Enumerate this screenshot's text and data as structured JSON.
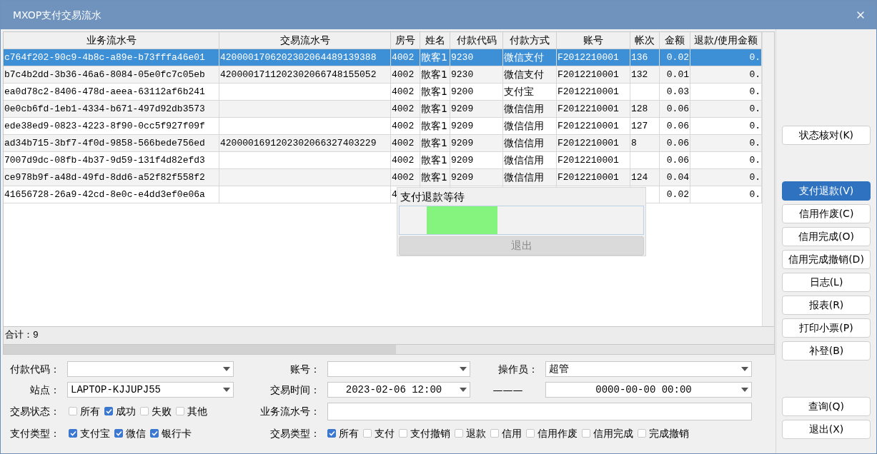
{
  "window": {
    "title": "MXOP支付交易流水"
  },
  "table": {
    "columns": [
      "业务流水号",
      "交易流水号",
      "房号",
      "姓名",
      "付款代码",
      "付款方式",
      "账号",
      "帐次",
      "金额",
      "退款/使用金额"
    ],
    "rows": [
      {
        "selected": true,
        "business_no": "c764f202-90c9-4b8c-a89e-b73fffa46e01",
        "trade_no": "4200001706202302064489139388",
        "room": "4002",
        "name": "散客1",
        "pay_code": "9230",
        "pay_method": "微信支付",
        "account": "F2012210001",
        "folio": "136",
        "amount": "0.02",
        "refund": "0."
      },
      {
        "selected": false,
        "business_no": "b7c4b2dd-3b36-46a6-8084-05e0fc7c05eb",
        "trade_no": "4200001711202302066748155052",
        "room": "4002",
        "name": "散客1",
        "pay_code": "9230",
        "pay_method": "微信支付",
        "account": "F2012210001",
        "folio": "132",
        "amount": "0.01",
        "refund": "0."
      },
      {
        "selected": false,
        "business_no": "ea0d78c2-8406-478d-aeea-63112af6b241",
        "room": "4002",
        "name": "散客1",
        "pay_code": "9200",
        "pay_method": "支付宝",
        "account": "F2012210001",
        "amount": "0.03",
        "refund": "0."
      },
      {
        "selected": false,
        "business_no": "0e0cb6fd-1eb1-4334-b671-497d92db3573",
        "room": "4002",
        "name": "散客1",
        "pay_code": "9209",
        "pay_method": "微信信用",
        "account": "F2012210001",
        "folio": "128",
        "amount": "0.06",
        "refund": "0."
      },
      {
        "selected": false,
        "business_no": "ede38ed9-0823-4223-8f90-0cc5f927f09f",
        "room": "4002",
        "name": "散客1",
        "pay_code": "9209",
        "pay_method": "微信信用",
        "account": "F2012210001",
        "folio": "127",
        "amount": "0.06",
        "refund": "0."
      },
      {
        "selected": false,
        "business_no": "ad34b715-3bf7-4f0d-9858-566bede756ed",
        "trade_no": "4200001691202302066327403229",
        "room": "4002",
        "name": "散客1",
        "pay_code": "9209",
        "pay_method": "微信信用",
        "account": "F2012210001",
        "folio": "8",
        "amount": "0.06",
        "refund": "0."
      },
      {
        "selected": false,
        "business_no": "7007d9dc-08fb-4b37-9d59-131f4d82efd3",
        "room": "4002",
        "name": "散客1",
        "pay_code": "9209",
        "pay_method": "微信信用",
        "account": "F2012210001",
        "amount": "0.06",
        "refund": "0."
      },
      {
        "selected": false,
        "business_no": "ce978b9f-a48d-49fd-8dd6-a52f82f558f2",
        "room": "4002",
        "name": "散客1",
        "pay_code": "9209",
        "pay_method": "微信信用",
        "account": "F2012210001",
        "folio": "124",
        "amount": "0.04",
        "refund": "0."
      },
      {
        "selected": false,
        "business_no": "41656728-26a9-42cd-8e0c-e4dd3ef0e06a",
        "room": "4",
        "amount": "0.02",
        "refund": "0."
      }
    ],
    "total": "合计：9"
  },
  "dialog": {
    "title": "支付退款等待",
    "progress": {
      "level": 0.29
    },
    "button": {
      "label": "退出",
      "disabled": true
    }
  },
  "filters": {
    "row1": [
      {
        "label": "付款代码：",
        "kind": "dropdown"
      },
      {
        "label": "账号：",
        "kind": "dropdown"
      },
      {
        "label": "操作员：",
        "kind": "dropdown",
        "value": "超管"
      }
    ],
    "row2": [
      {
        "label": "站点：",
        "kind": "dropdown",
        "value": "LAPTOP-KJJUPJ55"
      },
      {
        "label": "交易时间：",
        "kind": "dropdown",
        "value": "2023-02-06 12:00",
        "separator": "———",
        "to": {
          "kind": "dropdown",
          "value": "0000-00-00 00:00"
        }
      }
    ],
    "trade_status": {
      "label": "交易状态：",
      "options": [
        {
          "label": "所有",
          "checked": false
        },
        {
          "label": "成功",
          "checked": true
        },
        {
          "label": "失败",
          "checked": false
        },
        {
          "label": "其他",
          "checked": false
        }
      ]
    },
    "business_no": {
      "label": "业务流水号："
    },
    "pay_type": {
      "label": "支付类型：",
      "options": [
        {
          "label": "支付宝",
          "checked": true
        },
        {
          "label": "微信",
          "checked": true
        },
        {
          "label": "银行卡",
          "checked": true
        }
      ]
    },
    "trade_type": {
      "label": "交易类型：",
      "options": [
        {
          "label": "所有",
          "checked": true
        },
        {
          "label": "支付",
          "checked": false
        },
        {
          "label": "支付撤销",
          "checked": false
        },
        {
          "label": "退款",
          "checked": false
        },
        {
          "label": "信用",
          "checked": false
        },
        {
          "label": "信用作废",
          "checked": false
        },
        {
          "label": "信用完成",
          "checked": false
        },
        {
          "label": "完成撤销",
          "checked": false
        }
      ]
    }
  },
  "actions": {
    "top": [
      {
        "label": "状态核对(K)",
        "selected": false
      }
    ],
    "middle": [
      {
        "label": "支付退款(V)",
        "selected": true
      },
      {
        "label": "信用作废(C)",
        "selected": false
      },
      {
        "label": "信用完成(O)",
        "selected": false
      },
      {
        "label": "信用完成撤销(D)",
        "selected": false
      },
      {
        "label": "日志(L)",
        "selected": false
      },
      {
        "label": "报表(R)",
        "selected": false
      },
      {
        "label": "打印小票(P)",
        "selected": false
      },
      {
        "label": "补登(B)",
        "selected": false
      }
    ],
    "bottom": [
      {
        "label": "查询(Q)",
        "selected": false
      },
      {
        "label": "退出(X)",
        "selected": false
      }
    ]
  }
}
